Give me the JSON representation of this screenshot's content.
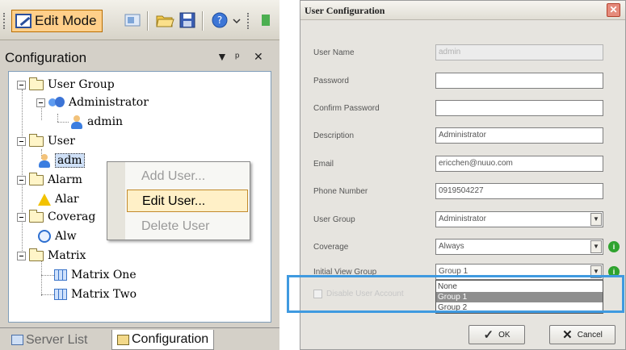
{
  "toolbar": {
    "edit_mode_label": "Edit Mode"
  },
  "panel": {
    "title": "Configuration",
    "pin_glyph": "▼  ᵖ  ✕"
  },
  "tree": {
    "user_group": "User Group",
    "administrator": "Administrator",
    "admin_child": "admin",
    "user": "User",
    "user_admin": "adm",
    "alarm": "Alarm",
    "alarm_child": "Alar",
    "coverage": "Coverag",
    "coverage_child": "Alw",
    "matrix": "Matrix",
    "matrix_one": "Matrix One",
    "matrix_two": "Matrix Two"
  },
  "context_menu": {
    "items": [
      "Add User...",
      "Edit User...",
      "Delete User"
    ]
  },
  "bottom_tabs": [
    "Server List",
    "Configuration"
  ],
  "dialog": {
    "title": "User Configuration",
    "close_glyph": "✕",
    "fields": {
      "user_name": {
        "label": "User Name",
        "value": "admin"
      },
      "password": {
        "label": "Password",
        "value": ""
      },
      "confirm_password": {
        "label": "Confirm Password",
        "value": ""
      },
      "description": {
        "label": "Description",
        "value": "Administrator"
      },
      "email": {
        "label": "Email",
        "value": "ericchen@nuuo.com"
      },
      "phone": {
        "label": "Phone Number",
        "value": "0919504227"
      },
      "user_group": {
        "label": "User Group",
        "value": "Administrator"
      },
      "coverage": {
        "label": "Coverage",
        "value": "Always"
      },
      "initial_view_group": {
        "label": "Initial View Group",
        "value": "Group 1"
      }
    },
    "dropdown_options": [
      "None",
      "Group 1",
      "Group 2"
    ],
    "disable_account_label": "Disable User Account",
    "ok_label": "OK",
    "cancel_label": "Cancel",
    "combo_arrow": "▼",
    "info_glyph": "i",
    "ok_glyph": "✓",
    "cancel_glyph": "✕"
  },
  "colors": {
    "selection": "#fff0c7",
    "highlight_border": "#3f9ae0",
    "edit_mode_bg": "#ffcf8a"
  }
}
